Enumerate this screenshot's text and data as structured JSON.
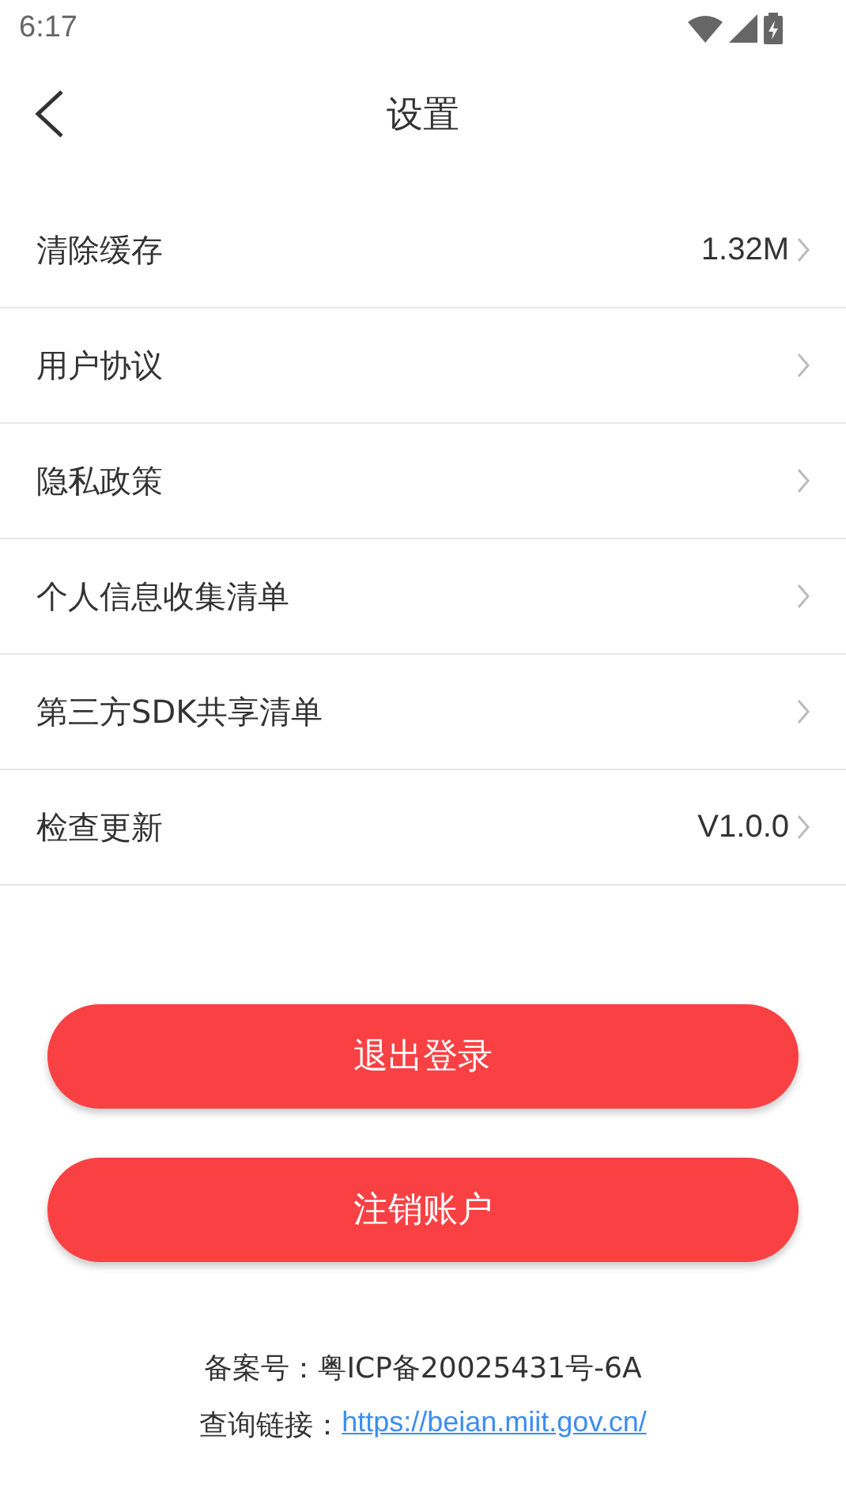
{
  "status_bar": {
    "time": "6:17"
  },
  "header": {
    "title": "设置"
  },
  "items": [
    {
      "label": "清除缓存",
      "value": "1.32M"
    },
    {
      "label": "用户协议"
    },
    {
      "label": "隐私政策"
    },
    {
      "label": "个人信息收集清单"
    },
    {
      "label": "第三方SDK共享清单"
    },
    {
      "label": "检查更新",
      "value": "V1.0.0"
    }
  ],
  "buttons": [
    "退出登录",
    "注销账户"
  ],
  "footer": {
    "record": "备案号：粤ICP备20025431号-6A",
    "link_label": "查询链接：",
    "link": "https://beian.miit.gov.cn/"
  }
}
